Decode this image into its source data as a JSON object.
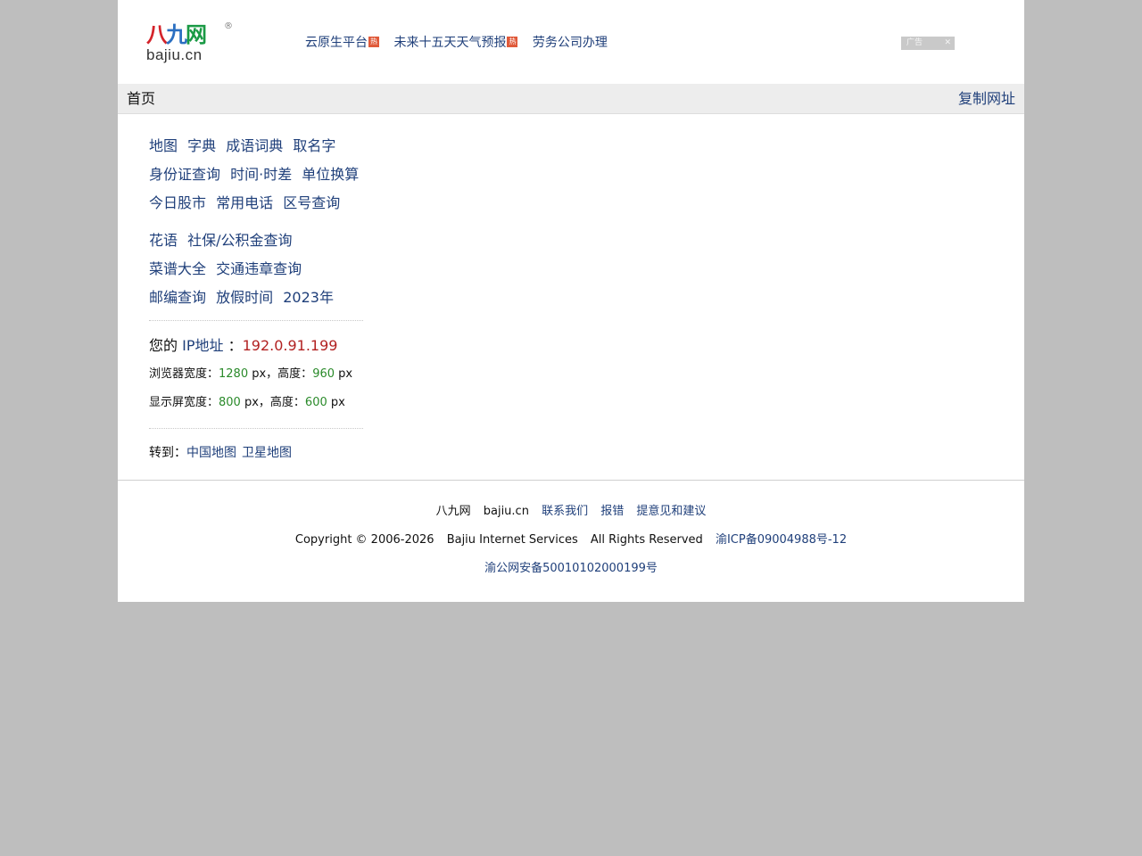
{
  "logo": {
    "cn_char_1": "八",
    "cn_char_2": "九",
    "cn_char_3": "网",
    "en": "bajiu.cn",
    "reg": "®"
  },
  "top_links": [
    {
      "label": "云原生平台",
      "hot": "热"
    },
    {
      "label": "未来十五天天气预报",
      "hot": "热"
    },
    {
      "label": "劳务公司办理",
      "hot": ""
    }
  ],
  "ad": {
    "label": "广告",
    "close": "✕"
  },
  "navbar": {
    "home": "首页",
    "copy_url": "复制网址"
  },
  "link_groups": [
    [
      [
        "地图",
        "字典",
        "成语词典",
        "取名字"
      ],
      [
        "身份证查询",
        "时间·时差",
        "单位换算"
      ],
      [
        "今日股市",
        "常用电话",
        "区号查询"
      ]
    ],
    [
      [
        "花语",
        "社保/公积金查询"
      ],
      [
        "菜谱大全",
        "交通违章查询"
      ],
      [
        "邮编查询",
        "放假时间",
        "2023年"
      ]
    ]
  ],
  "ip": {
    "prefix": "您的",
    "link": "IP地址",
    "colon": "：",
    "value": "192.0.91.199"
  },
  "browser": {
    "label_w": "浏览器宽度：",
    "width": "1280",
    "mid": " px，高度：",
    "height": "960",
    "unit": " px"
  },
  "screen": {
    "label_w": "显示屏宽度：",
    "width": "800",
    "mid": " px，高度：",
    "height": "600",
    "unit": " px"
  },
  "goto": {
    "label": "转到：",
    "links": [
      "中国地图",
      "卫星地图"
    ]
  },
  "footer": {
    "line1": {
      "site": "八九网",
      "domain": "bajiu.cn",
      "links": [
        "联系我们",
        "报错",
        "提意见和建议"
      ]
    },
    "line2": {
      "copyright": "Copyright © 2006-2026",
      "company": "Bajiu Internet Services",
      "rights": "All Rights Reserved",
      "icp": "渝ICP备09004988号-12"
    },
    "line3": {
      "police": "渝公网安备50010102000199号"
    }
  }
}
